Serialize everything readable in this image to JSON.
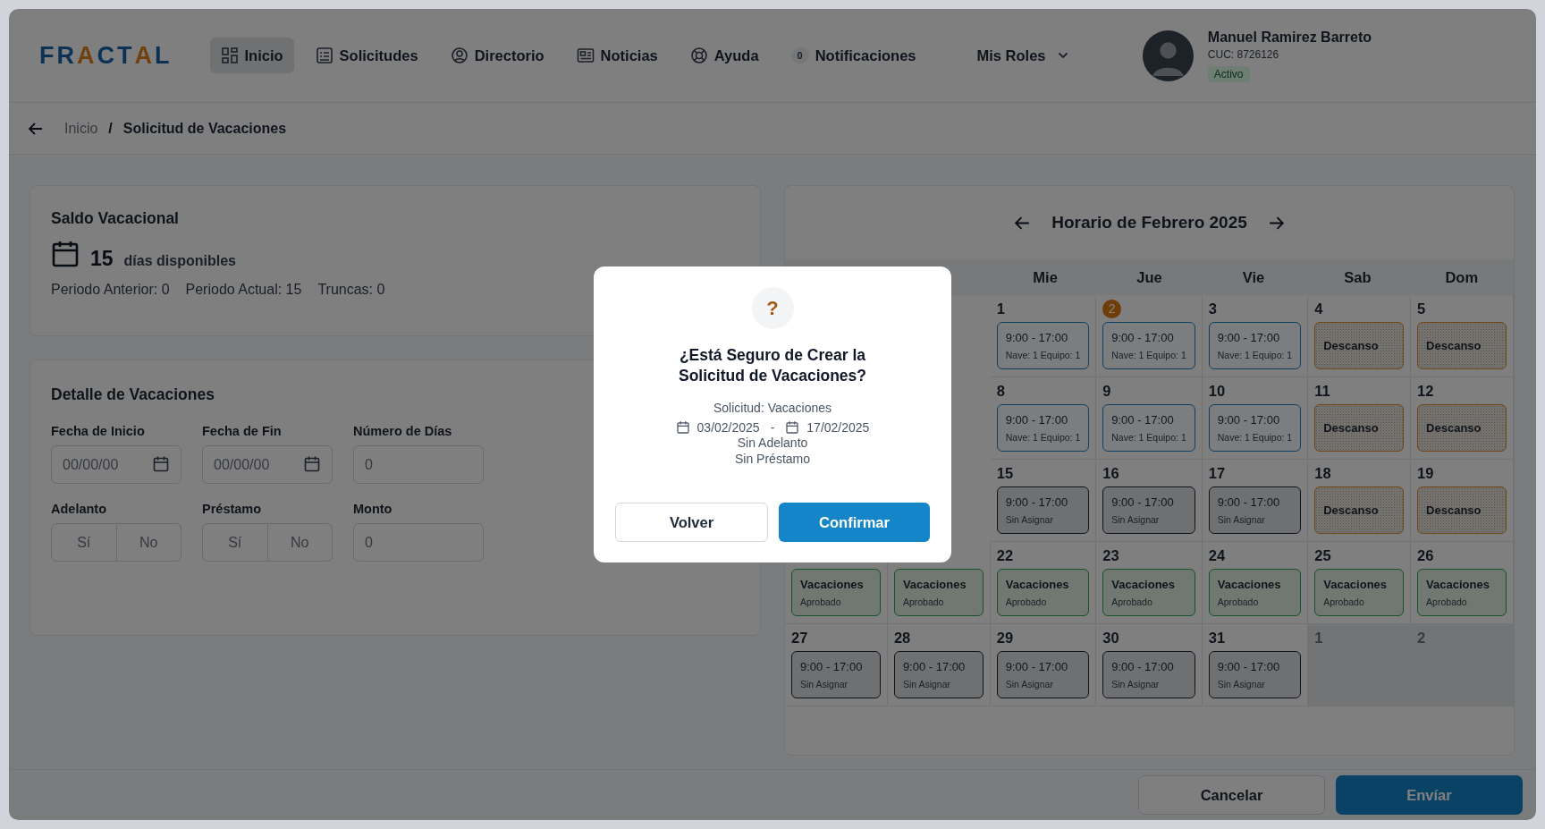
{
  "logo": [
    {
      "text": "FR",
      "accent": false
    },
    {
      "text": "A",
      "accent": true
    },
    {
      "text": "CT",
      "accent": false
    },
    {
      "text": "A",
      "accent": true
    },
    {
      "text": "L",
      "accent": false
    }
  ],
  "nav": [
    {
      "label": "Inicio",
      "selected": true
    },
    {
      "label": "Solicitudes",
      "selected": false
    },
    {
      "label": "Directorio",
      "selected": false
    },
    {
      "label": "Noticias",
      "selected": false
    },
    {
      "label": "Ayuda",
      "selected": false
    },
    {
      "label": "Notificaciones",
      "badge": "0",
      "selected": false
    }
  ],
  "roles_menu": {
    "label": "Mis Roles"
  },
  "user": {
    "name": "Manuel Ramirez Barreto",
    "code": "CUC: 8726126",
    "status": "Activo"
  },
  "breadcrumb": {
    "items": [
      {
        "label": "Inicio",
        "current": false
      },
      {
        "label": "Solicitud de Vacaciones",
        "current": true
      }
    ],
    "separator": "/"
  },
  "balance": {
    "title": "Saldo Vacacional",
    "days": "15",
    "days_label": "días disponibles",
    "stats": [
      "Periodo Anterior: 0",
      "Periodo Actual: 15",
      "Truncas: 0"
    ]
  },
  "details": {
    "title": "Detalle de Vacaciones",
    "fields": [
      {
        "kind": "date",
        "label": "Fecha de Inicio",
        "placeholder": "00/00/00"
      },
      {
        "kind": "date",
        "label": "Fecha de Fin",
        "placeholder": "00/00/00"
      },
      {
        "kind": "text",
        "label": "Número de Días",
        "placeholder": "0"
      },
      {
        "kind": "toggle",
        "label": "Adelanto",
        "options": [
          {
            "label": "Sí",
            "selected": false
          },
          {
            "label": "No",
            "selected": false
          }
        ]
      },
      {
        "kind": "toggle",
        "label": "Préstamo",
        "options": [
          {
            "label": "Sí",
            "selected": false
          },
          {
            "label": "No",
            "selected": false
          }
        ]
      },
      {
        "kind": "text",
        "label": "Monto",
        "placeholder": "0"
      }
    ]
  },
  "calendar": {
    "title": "Horario de Febrero 2025",
    "weekdays": [
      "Mie",
      "Jue",
      "Vie",
      "Sab",
      "Dom"
    ],
    "weeks": [
      [
        {
          "day": "1",
          "muted": false,
          "today": false,
          "shift": {
            "kind": "turno",
            "title": "9:00 - 17:00",
            "detail": "Nave: 1 Equipo: 1"
          }
        },
        {
          "day": "2",
          "muted": false,
          "today": true,
          "shift": {
            "kind": "turno",
            "title": "9:00 - 17:00",
            "detail": "Nave: 1 Equipo: 1"
          }
        },
        {
          "day": "3",
          "muted": false,
          "today": false,
          "shift": {
            "kind": "turno",
            "title": "9:00 - 17:00",
            "detail": "Nave: 1 Equipo: 1"
          }
        },
        {
          "day": "4",
          "muted": false,
          "today": false,
          "shift": {
            "kind": "descanso",
            "title": "Descanso"
          }
        },
        {
          "day": "5",
          "muted": false,
          "today": false,
          "shift": {
            "kind": "descanso",
            "title": "Descanso"
          }
        }
      ],
      [
        {
          "day": "8",
          "muted": false,
          "today": false,
          "shift": {
            "kind": "turno",
            "title": "9:00 - 17:00",
            "detail": "Nave: 1 Equipo: 1"
          }
        },
        {
          "day": "9",
          "muted": false,
          "today": false,
          "shift": {
            "kind": "turno",
            "title": "9:00 - 17:00",
            "detail": "Nave: 1 Equipo: 1"
          }
        },
        {
          "day": "10",
          "muted": false,
          "today": false,
          "shift": {
            "kind": "turno",
            "title": "9:00 - 17:00",
            "detail": "Nave: 1 Equipo: 1"
          }
        },
        {
          "day": "11",
          "muted": false,
          "today": false,
          "shift": {
            "kind": "descanso",
            "title": "Descanso"
          }
        },
        {
          "day": "12",
          "muted": false,
          "today": false,
          "shift": {
            "kind": "descanso",
            "title": "Descanso"
          }
        }
      ],
      [
        {
          "day": "15",
          "muted": false,
          "today": false,
          "shift": {
            "kind": "sin_asignar",
            "title": "9:00 - 17:00",
            "detail": "Sin Asignar"
          }
        },
        {
          "day": "16",
          "muted": false,
          "today": false,
          "shift": {
            "kind": "sin_asignar",
            "title": "9:00 - 17:00",
            "detail": "Sin Asignar"
          }
        },
        {
          "day": "17",
          "muted": false,
          "today": false,
          "shift": {
            "kind": "sin_asignar",
            "title": "9:00 - 17:00",
            "detail": "Sin Asignar"
          }
        },
        {
          "day": "18",
          "muted": false,
          "today": false,
          "shift": {
            "kind": "descanso",
            "title": "Descanso"
          }
        },
        {
          "day": "19",
          "muted": false,
          "today": false,
          "shift": {
            "kind": "descanso",
            "title": "Descanso"
          }
        }
      ],
      [
        {
          "muted": false,
          "shift": {
            "kind": "vacaciones",
            "title": "Vacaciones",
            "detail": "Aprobado"
          }
        },
        {
          "muted": false,
          "shift": {
            "kind": "vacaciones",
            "title": "Vacaciones",
            "detail": "Aprobado"
          }
        },
        {
          "day": "22",
          "muted": false,
          "today": false,
          "shift": {
            "kind": "vacaciones",
            "title": "Vacaciones",
            "detail": "Aprobado"
          }
        },
        {
          "day": "23",
          "muted": false,
          "today": false,
          "shift": {
            "kind": "vacaciones",
            "title": "Vacaciones",
            "detail": "Aprobado"
          }
        },
        {
          "day": "24",
          "muted": false,
          "today": false,
          "shift": {
            "kind": "vacaciones",
            "title": "Vacaciones",
            "detail": "Aprobado"
          }
        },
        {
          "day": "25",
          "muted": false,
          "today": false,
          "shift": {
            "kind": "vacaciones",
            "title": "Vacaciones",
            "detail": "Aprobado"
          }
        },
        {
          "day": "26",
          "muted": false,
          "today": false,
          "shift": {
            "kind": "vacaciones",
            "title": "Vacaciones",
            "detail": "Aprobado"
          }
        }
      ],
      [
        {
          "day": "27",
          "muted": false,
          "today": false,
          "shift": {
            "kind": "sin_asignar",
            "title": "9:00 - 17:00",
            "detail": "Sin Asignar"
          }
        },
        {
          "day": "28",
          "muted": false,
          "today": false,
          "shift": {
            "kind": "sin_asignar",
            "title": "9:00 - 17:00",
            "detail": "Sin Asignar"
          }
        },
        {
          "day": "29",
          "muted": false,
          "today": false,
          "shift": {
            "kind": "sin_asignar",
            "title": "9:00 - 17:00",
            "detail": "Sin Asignar"
          }
        },
        {
          "day": "30",
          "muted": false,
          "today": false,
          "shift": {
            "kind": "sin_asignar",
            "title": "9:00 - 17:00",
            "detail": "Sin Asignar"
          }
        },
        {
          "day": "31",
          "muted": false,
          "today": false,
          "shift": {
            "kind": "sin_asignar",
            "title": "9:00 - 17:00",
            "detail": "Sin Asignar"
          }
        },
        {
          "day": "1",
          "muted": true,
          "today": false
        },
        {
          "day": "2",
          "muted": true,
          "today": false
        }
      ]
    ]
  },
  "footer": {
    "buttons": [
      {
        "label": "Cancelar",
        "kind": "secondary"
      },
      {
        "label": "Envíar",
        "kind": "primary"
      }
    ]
  },
  "dialog": {
    "icon": "?",
    "title": "¿Está Seguro de Crear la Solicitud de Vacaciones?",
    "type": "Solicitud: Vacaciones",
    "start": "03/02/2025",
    "separator": "-",
    "end": "17/02/2025",
    "notes": [
      "Sin Adelanto",
      "Sin Préstamo"
    ],
    "buttons": [
      {
        "label": "Volver",
        "kind": "secondary"
      },
      {
        "label": "Confirmar",
        "kind": "primary"
      }
    ]
  }
}
